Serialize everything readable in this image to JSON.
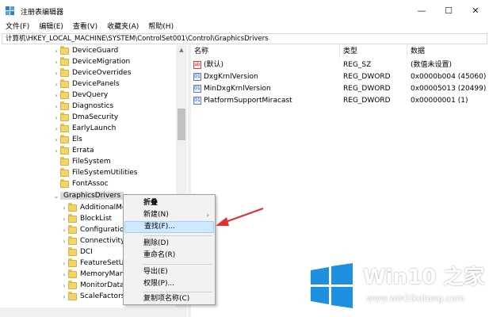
{
  "window": {
    "title": "注册表编辑器"
  },
  "controls": {
    "minimize": "—",
    "maximize": "☐",
    "close": "✕"
  },
  "menu": [
    "文件(F)",
    "编辑(E)",
    "查看(V)",
    "收藏夹(A)",
    "帮助(H)"
  ],
  "address": "计算机\\HKEY_LOCAL_MACHINE\\SYSTEM\\ControlSet001\\Control\\GraphicsDrivers",
  "tree": {
    "items": [
      {
        "label": "DeviceGuard",
        "level": 0
      },
      {
        "label": "DeviceMigration",
        "level": 0
      },
      {
        "label": "DeviceOverrides",
        "level": 0
      },
      {
        "label": "DevicePanels",
        "level": 0
      },
      {
        "label": "DevQuery",
        "level": 0
      },
      {
        "label": "Diagnostics",
        "level": 0
      },
      {
        "label": "DmaSecurity",
        "level": 0
      },
      {
        "label": "EarlyLaunch",
        "level": 0
      },
      {
        "label": "Els",
        "level": 0
      },
      {
        "label": "Errata",
        "level": 0
      },
      {
        "label": "FileSystem",
        "level": 0
      },
      {
        "label": "FileSystemUtilities",
        "level": 0
      },
      {
        "label": "FontAssoc",
        "level": 0
      },
      {
        "label": "GraphicsDrivers",
        "level": 0,
        "expanded": true,
        "selected": true
      },
      {
        "label": "AdditionalMo",
        "level": 1
      },
      {
        "label": "BlockList",
        "level": 1
      },
      {
        "label": "Configuration",
        "level": 1
      },
      {
        "label": "Connectivity",
        "level": 1
      },
      {
        "label": "DCI",
        "level": 1
      },
      {
        "label": "FeatureSetUs",
        "level": 1
      },
      {
        "label": "MemoryMan",
        "level": 1
      },
      {
        "label": "MonitorDataS",
        "level": 1
      },
      {
        "label": "ScaleFactors",
        "level": 1
      }
    ]
  },
  "values": {
    "headers": {
      "name": "名称",
      "type": "类型",
      "data": "数据"
    },
    "rows": [
      {
        "icon": "ab",
        "name": "(默认)",
        "type": "REG_SZ",
        "data": "(数值未设置)"
      },
      {
        "icon": "01",
        "name": "DxgKrnlVersion",
        "type": "REG_DWORD",
        "data": "0x0000b004 (45060)"
      },
      {
        "icon": "01",
        "name": "MinDxgKrnlVersion",
        "type": "REG_DWORD",
        "data": "0x00005013 (20499)"
      },
      {
        "icon": "01",
        "name": "PlatformSupportMiracast",
        "type": "REG_DWORD",
        "data": "0x00000001 (1)"
      }
    ]
  },
  "context_menu": {
    "collapse": "折叠",
    "new": "新建(N)",
    "find": "查找(F)...",
    "delete": "删除(D)",
    "rename": "重命名(R)",
    "export": "导出(E)",
    "permissions": "权限(P)...",
    "copy_key_name": "复制项名称(C)"
  },
  "watermark": {
    "title": "Win10 之家",
    "url": "www.win10xitong.com"
  },
  "colors": {
    "accent": "#0078d7",
    "highlight": "#cde8ff",
    "arrow": "#e03030",
    "watermark_blue": "#1e90e0"
  }
}
